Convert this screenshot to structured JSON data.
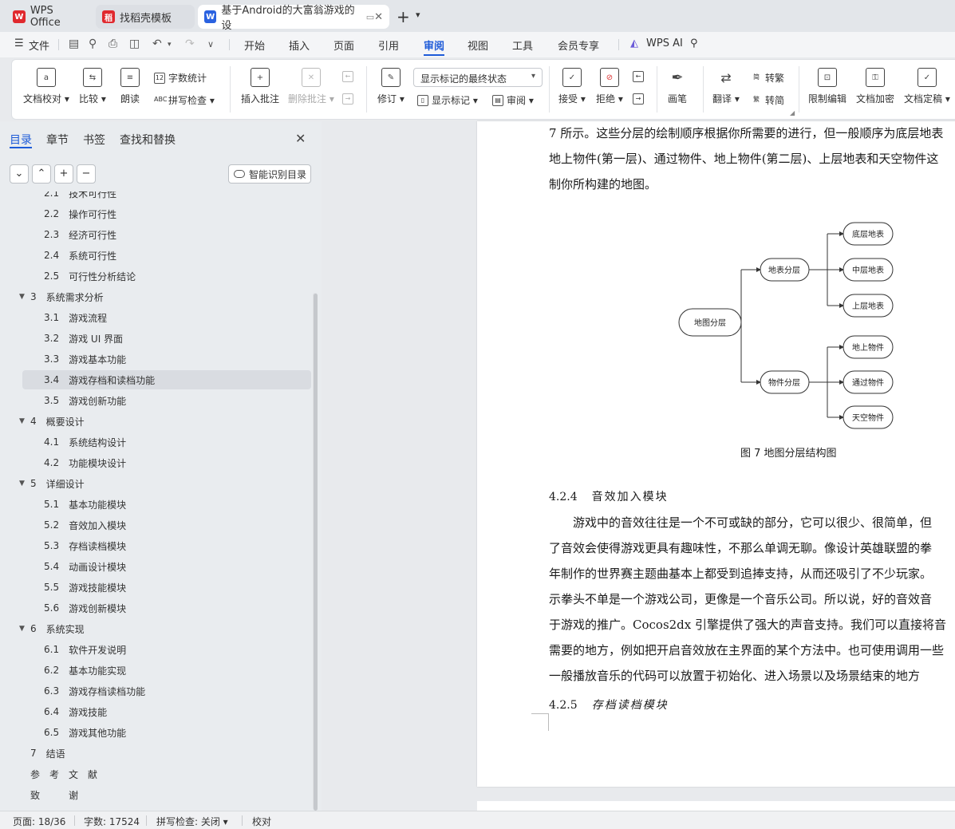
{
  "tabs": [
    {
      "label": "WPS Office"
    },
    {
      "label": "找稻壳模板"
    },
    {
      "label": "基于Android的大富翁游戏的设"
    }
  ],
  "menu": {
    "file": "文件",
    "items": [
      "开始",
      "插入",
      "页面",
      "引用",
      "审阅",
      "视图",
      "工具",
      "会员专享"
    ],
    "wps_ai": "WPS AI"
  },
  "ribbon": {
    "doc_proof": "文档校对",
    "compare": "比较",
    "read_aloud": "朗读",
    "word_count": "字数统计",
    "spell_check": "拼写检查",
    "insert_comment": "插入批注",
    "delete_comment": "删除批注",
    "revise": "修订",
    "markup_state": "显示标记的最终状态",
    "show_markup": "显示标记",
    "review": "审阅",
    "accept": "接受",
    "reject": "拒绝",
    "pen": "画笔",
    "translate": "翻译",
    "to_traditional": "转繁",
    "to_simplified": "转简",
    "restrict_edit": "限制编辑",
    "encrypt": "文档加密",
    "finalize": "文档定稿"
  },
  "pane": {
    "tabs": [
      "目录",
      "章节",
      "书签",
      "查找和替换"
    ],
    "smart_toc": "智能识别目录",
    "toc": [
      {
        "num": "2.1",
        "title": "技术可行性",
        "level": 2
      },
      {
        "num": "2.2",
        "title": "操作可行性",
        "level": 2
      },
      {
        "num": "2.3",
        "title": "经济可行性",
        "level": 2
      },
      {
        "num": "2.4",
        "title": "系统可行性",
        "level": 2
      },
      {
        "num": "2.5",
        "title": "可行性分析结论",
        "level": 2
      },
      {
        "num": "3",
        "title": "系统需求分析",
        "level": 1
      },
      {
        "num": "3.1",
        "title": "游戏流程",
        "level": 2
      },
      {
        "num": "3.2",
        "title": "游戏 UI 界面",
        "level": 2
      },
      {
        "num": "3.3",
        "title": "游戏基本功能",
        "level": 2
      },
      {
        "num": "3.4",
        "title": "游戏存档和读档功能",
        "level": 2,
        "selected": true
      },
      {
        "num": "3.5",
        "title": "游戏创新功能",
        "level": 2
      },
      {
        "num": "4",
        "title": "概要设计",
        "level": 1
      },
      {
        "num": "4.1",
        "title": "系统结构设计",
        "level": 2
      },
      {
        "num": "4.2",
        "title": "功能模块设计",
        "level": 2
      },
      {
        "num": "5",
        "title": "详细设计",
        "level": 1
      },
      {
        "num": "5.1",
        "title": "基本功能模块",
        "level": 2
      },
      {
        "num": "5.2",
        "title": "音效加入模块",
        "level": 2
      },
      {
        "num": "5.3",
        "title": "存档读档模块",
        "level": 2
      },
      {
        "num": "5.4",
        "title": "动画设计模块",
        "level": 2
      },
      {
        "num": "5.5",
        "title": "游戏技能模块",
        "level": 2
      },
      {
        "num": "5.6",
        "title": "游戏创新模块",
        "level": 2
      },
      {
        "num": "6",
        "title": "系统实现",
        "level": 1
      },
      {
        "num": "6.1",
        "title": "软件开发说明",
        "level": 2
      },
      {
        "num": "6.2",
        "title": "基本功能实现",
        "level": 2
      },
      {
        "num": "6.3",
        "title": "游戏存档读档功能",
        "level": 2
      },
      {
        "num": "6.4",
        "title": "游戏技能",
        "level": 2
      },
      {
        "num": "6.5",
        "title": "游戏其他功能",
        "level": 2
      },
      {
        "num": "7",
        "title": "结语",
        "level": 0
      },
      {
        "num": "",
        "title": "参　考　文　献",
        "level": 0
      },
      {
        "num": "",
        "title": "致　　　谢",
        "level": 0
      }
    ]
  },
  "document": {
    "lines_top": [
      "7 所示。这些分层的绘制顺序根据你所需要的进行，但一般顺序为底层地表",
      "地上物件(第一层)、通过物件、地上物件(第二层)、上层地表和天空物件这",
      "制你所构建的地图。"
    ],
    "diagram": {
      "root": "地图分层",
      "mid": [
        "地表分层",
        "物件分层"
      ],
      "leaves": [
        "底层地表",
        "中层地表",
        "上层地表",
        "地上物件",
        "通过物件",
        "天空物件"
      ]
    },
    "caption": "图 7  地图分层结构图",
    "sec424_num": "4.2.4",
    "sec424_title": "音效加入模块",
    "lines_body": [
      "　　游戏中的音效往往是一个不可或缺的部分，它可以很少、很简单，但",
      "了音效会使得游戏更具有趣味性，不那么单调无聊。像设计英雄联盟的拳",
      "年制作的世界赛主题曲基本上都受到追捧支持，从而还吸引了不少玩家。",
      "示拳头不单是一个游戏公司，更像是一个音乐公司。所以说，好的音效音",
      "于游戏的推广。Cocos2dx 引擎提供了强大的声音支持。我们可以直接将音",
      "需要的地方，例如把开启音效放在主界面的某个方法中。也可使用调用一些",
      "一般播放音乐的代码可以放置于初始化、进入场景以及场景结束的地方"
    ],
    "sec425_num": "4.2.5",
    "sec425_title": "存档读档模块"
  },
  "status": {
    "page": "页面: 18/36",
    "words": "字数: 17524",
    "spell": "拼写检查: 关闭",
    "proof": "校对"
  },
  "colors": {
    "accent": "#1e5bd8",
    "wps_red": "#e0292e"
  }
}
